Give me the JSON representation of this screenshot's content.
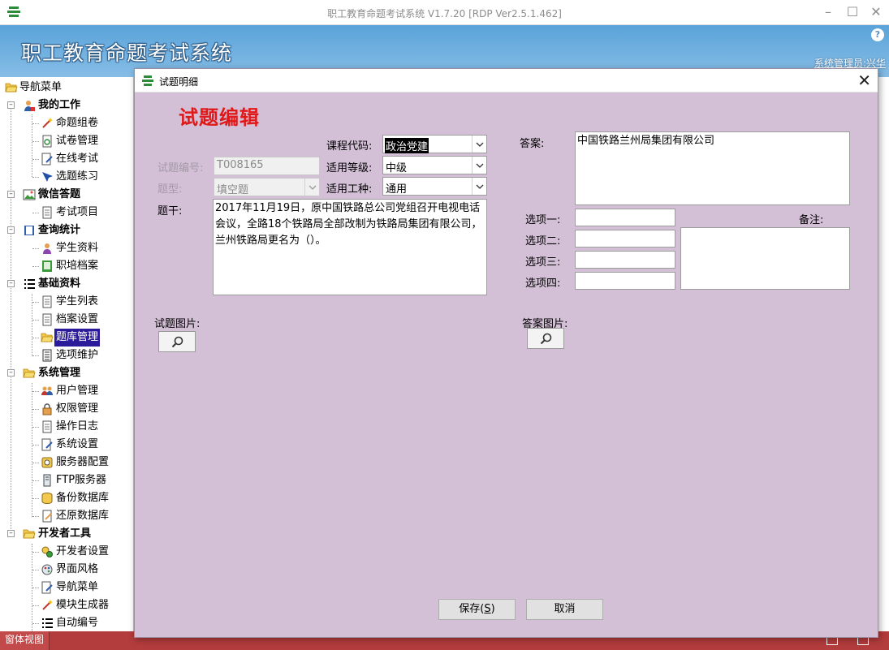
{
  "window": {
    "title": "职工教育命题考试系统 V1.7.20 [RDP Ver2.5.1.462]",
    "minimize": "–",
    "maximize": "☐",
    "close": "✕"
  },
  "header": {
    "banner": "职工教育命题考试系统",
    "help": "?",
    "user": "系统管理员:兴华"
  },
  "sidebar": {
    "root": "导航菜单",
    "groups": [
      {
        "label": "我的工作",
        "items": [
          "命题组卷",
          "试卷管理",
          "在线考试",
          "选题练习"
        ]
      },
      {
        "label": "微信答题",
        "items": [
          "考试项目"
        ]
      },
      {
        "label": "查询统计",
        "items": [
          "学生资料",
          "职培档案"
        ]
      },
      {
        "label": "基础资料",
        "items": [
          "学生列表",
          "档案设置",
          "题库管理",
          "选项维护"
        ]
      },
      {
        "label": "系统管理",
        "items": [
          "用户管理",
          "权限管理",
          "操作日志",
          "系统设置",
          "服务器配置",
          "FTP服务器",
          "备份数据库",
          "还原数据库"
        ]
      },
      {
        "label": "开发者工具",
        "items": [
          "开发者设置",
          "界面风格",
          "导航菜单",
          "模块生成器",
          "自动编号"
        ]
      }
    ],
    "selected": "题库管理"
  },
  "statusbar": {
    "tab": "窗体视图"
  },
  "dialog": {
    "title": "试题明细",
    "close": "✕",
    "heading": "试题编辑",
    "labels": {
      "course_code": "课程代码:",
      "question_no": "试题编号:",
      "level": "适用等级:",
      "type": "题型:",
      "job": "适用工种:",
      "stem": "题干:",
      "answer": "答案:",
      "option1": "选项一:",
      "option2": "选项二:",
      "option3": "选项三:",
      "option4": "选项四:",
      "remark": "备注:",
      "question_image": "试题图片:",
      "answer_image": "答案图片:"
    },
    "values": {
      "course_code": "政治党建",
      "question_no": "T008165",
      "level": "中级",
      "type": "填空题",
      "job": "通用",
      "stem": "2017年11月19日，原中国铁路总公司党组召开电视电话会议，全路18个铁路局全部改制为铁路局集团有限公司，兰州铁路局更名为（）。",
      "answer": "中国铁路兰州局集团有限公司",
      "option1": "",
      "option2": "",
      "option3": "",
      "option4": "",
      "remark": ""
    },
    "buttons": {
      "save_prefix": "保存(",
      "save_key": "S",
      "save_suffix": ")",
      "cancel": "取消"
    }
  }
}
